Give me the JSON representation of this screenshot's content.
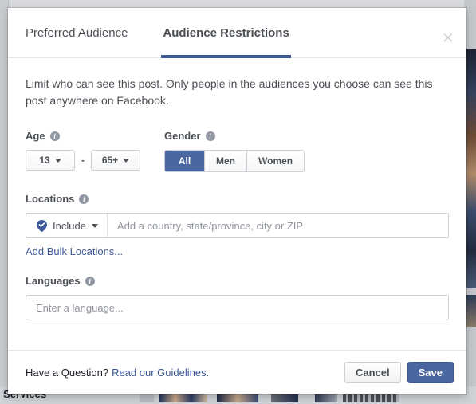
{
  "background": {
    "footer_label": "Services"
  },
  "modal": {
    "tabs": [
      {
        "label": "Preferred Audience",
        "active": false
      },
      {
        "label": "Audience Restrictions",
        "active": true
      }
    ],
    "close_icon": "×",
    "intro": "Limit who can see this post. Only people in the audiences you choose can see this post anywhere on Facebook.",
    "info_glyph": "i",
    "age": {
      "label": "Age",
      "min_value": "13",
      "max_value": "65+",
      "separator": "-"
    },
    "gender": {
      "label": "Gender",
      "options": [
        {
          "label": "All",
          "selected": true
        },
        {
          "label": "Men",
          "selected": false
        },
        {
          "label": "Women",
          "selected": false
        }
      ]
    },
    "locations": {
      "label": "Locations",
      "mode_label": "Include",
      "placeholder": "Add a country, state/province, city or ZIP",
      "value": "",
      "bulk_link": "Add Bulk Locations..."
    },
    "languages": {
      "label": "Languages",
      "placeholder": "Enter a language...",
      "value": ""
    },
    "footer": {
      "question_text": "Have a Question?",
      "guidelines_link": "Read our Guidelines.",
      "cancel_label": "Cancel",
      "save_label": "Save"
    }
  },
  "colors": {
    "brand_blue": "#3b5998",
    "selected_blue": "#4b67a1",
    "text_gray": "#4b4f56",
    "placeholder_gray": "#90949c"
  }
}
